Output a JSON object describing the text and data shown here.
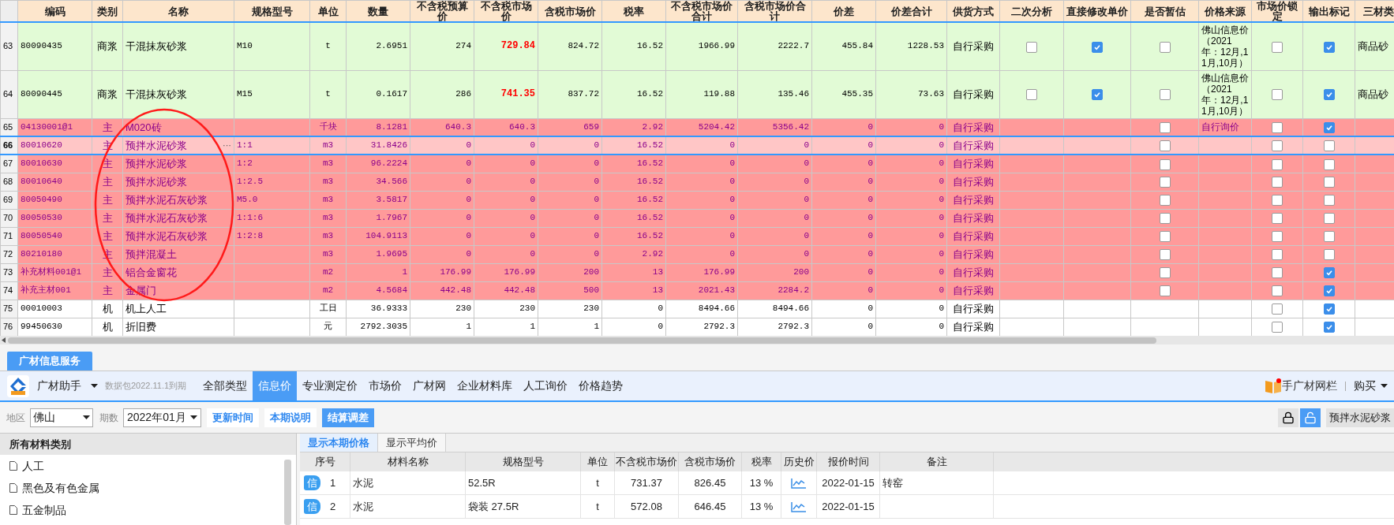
{
  "material_table": {
    "columns": [
      "编码",
      "类别",
      "名称",
      "规格型号",
      "单位",
      "数量",
      "不含税预算价",
      "不含税市场价",
      "含税市场价",
      "税率",
      "不含税市场价合计",
      "含税市场价合计",
      "价差",
      "价差合计",
      "供货方式",
      "二次分析",
      "直接修改单价",
      "是否暂估",
      "价格来源",
      "市场价锁定",
      "输出标记",
      "三材类"
    ],
    "rows": [
      {
        "no": "63",
        "kind": "priced",
        "selected": false,
        "market_highlight": true,
        "cells": [
          "80090435",
          "商浆",
          "干混抹灰砂浆",
          "M10",
          "t",
          "2.6951",
          "274",
          "729.84",
          "824.72",
          "16.52",
          "1966.99",
          "2222.7",
          "455.84",
          "1228.53",
          "自行采购"
        ],
        "secondary": false,
        "direct_edit": true,
        "provisional": false,
        "price_source": "佛山信息价（2021年：12月,11月,10月）",
        "locked": false,
        "output": true,
        "three_materials": "商品砂"
      },
      {
        "no": "64",
        "kind": "priced",
        "selected": false,
        "market_highlight": true,
        "cells": [
          "80090445",
          "商浆",
          "干混抹灰砂浆",
          "M15",
          "t",
          "0.1617",
          "286",
          "741.35",
          "837.72",
          "16.52",
          "119.88",
          "135.46",
          "455.35",
          "73.63",
          "自行采购"
        ],
        "secondary": false,
        "direct_edit": true,
        "provisional": false,
        "price_source": "佛山信息价（2021年：12月,11月,10月）",
        "locked": false,
        "output": true,
        "three_materials": "商品砂"
      },
      {
        "no": "65",
        "kind": "main",
        "selected": false,
        "market_highlight": false,
        "cells": [
          "04130001@1",
          "主",
          "M020砖",
          "",
          "千块",
          "8.1281",
          "640.3",
          "640.3",
          "659",
          "2.92",
          "5204.42",
          "5356.42",
          "0",
          "0",
          "自行采购"
        ],
        "provisional": false,
        "price_source": "自行询价",
        "locked": false,
        "output": true
      },
      {
        "no": "66",
        "kind": "main",
        "selected": true,
        "market_highlight": false,
        "picker": "···",
        "cells": [
          "80010620",
          "主",
          "预拌水泥砂浆",
          "1:1",
          "m3",
          "31.8426",
          "0",
          "0",
          "0",
          "16.52",
          "0",
          "0",
          "0",
          "0",
          "自行采购"
        ],
        "provisional": false,
        "locked": false,
        "output": false
      },
      {
        "no": "67",
        "kind": "main",
        "selected": false,
        "market_highlight": false,
        "cells": [
          "80010630",
          "主",
          "预拌水泥砂浆",
          "1:2",
          "m3",
          "96.2224",
          "0",
          "0",
          "0",
          "16.52",
          "0",
          "0",
          "0",
          "0",
          "自行采购"
        ],
        "provisional": false,
        "locked": false,
        "output": false
      },
      {
        "no": "68",
        "kind": "main",
        "selected": false,
        "market_highlight": false,
        "cells": [
          "80010640",
          "主",
          "预拌水泥砂浆",
          "1:2.5",
          "m3",
          "34.566",
          "0",
          "0",
          "0",
          "16.52",
          "0",
          "0",
          "0",
          "0",
          "自行采购"
        ],
        "provisional": false,
        "locked": false,
        "output": false
      },
      {
        "no": "69",
        "kind": "main",
        "selected": false,
        "market_highlight": false,
        "cells": [
          "80050490",
          "主",
          "预拌水泥石灰砂浆",
          "M5.0",
          "m3",
          "3.5817",
          "0",
          "0",
          "0",
          "16.52",
          "0",
          "0",
          "0",
          "0",
          "自行采购"
        ],
        "provisional": false,
        "locked": false,
        "output": false
      },
      {
        "no": "70",
        "kind": "main",
        "selected": false,
        "market_highlight": false,
        "cells": [
          "80050530",
          "主",
          "预拌水泥石灰砂浆",
          "1:1:6",
          "m3",
          "1.7967",
          "0",
          "0",
          "0",
          "16.52",
          "0",
          "0",
          "0",
          "0",
          "自行采购"
        ],
        "provisional": false,
        "locked": false,
        "output": false
      },
      {
        "no": "71",
        "kind": "main",
        "selected": false,
        "market_highlight": false,
        "cells": [
          "80050540",
          "主",
          "预拌水泥石灰砂浆",
          "1:2:8",
          "m3",
          "104.9113",
          "0",
          "0",
          "0",
          "16.52",
          "0",
          "0",
          "0",
          "0",
          "自行采购"
        ],
        "provisional": false,
        "locked": false,
        "output": false
      },
      {
        "no": "72",
        "kind": "main",
        "selected": false,
        "market_highlight": false,
        "cells": [
          "80210180",
          "主",
          "预拌混凝土",
          "",
          "m3",
          "1.9695",
          "0",
          "0",
          "0",
          "2.92",
          "0",
          "0",
          "0",
          "0",
          "自行采购"
        ],
        "provisional": false,
        "locked": false,
        "output": false
      },
      {
        "no": "73",
        "kind": "main",
        "selected": false,
        "market_highlight": false,
        "cells": [
          "补充材料001@1",
          "主",
          "铝合金窗花",
          "",
          "m2",
          "1",
          "176.99",
          "176.99",
          "200",
          "13",
          "176.99",
          "200",
          "0",
          "0",
          "自行采购"
        ],
        "provisional": false,
        "locked": false,
        "output": true
      },
      {
        "no": "74",
        "kind": "main",
        "selected": false,
        "market_highlight": false,
        "cells": [
          "补充主材001",
          "主",
          "金属门",
          "",
          "m2",
          "4.5684",
          "442.48",
          "442.48",
          "500",
          "13",
          "2021.43",
          "2284.2",
          "0",
          "0",
          "自行采购"
        ],
        "provisional": false,
        "locked": false,
        "output": true
      },
      {
        "no": "75",
        "kind": "machine",
        "selected": false,
        "market_highlight": false,
        "cells": [
          "00010003",
          "机",
          "机上人工",
          "",
          "工日",
          "36.9333",
          "230",
          "230",
          "230",
          "0",
          "8494.66",
          "8494.66",
          "0",
          "0",
          "自行采购"
        ],
        "locked": false,
        "output": true
      },
      {
        "no": "76",
        "kind": "machine",
        "selected": false,
        "market_highlight": false,
        "cells": [
          "99450630",
          "机",
          "折旧费",
          "",
          "元",
          "2792.3035",
          "1",
          "1",
          "1",
          "0",
          "2792.3",
          "2792.3",
          "0",
          "0",
          "自行采购"
        ],
        "locked": false,
        "output": true
      }
    ]
  },
  "service_tab": {
    "label": "广材信息服务"
  },
  "toolbar": {
    "app_name": "广材助手",
    "package_note": "数据包2022.11.1到期",
    "nav": [
      {
        "label": "全部类型",
        "selected": false
      },
      {
        "label": "信息价",
        "selected": true
      },
      {
        "label": "专业测定价",
        "selected": false
      },
      {
        "label": "市场价",
        "selected": false
      },
      {
        "label": "广材网",
        "selected": false
      },
      {
        "label": "企业材料库",
        "selected": false
      },
      {
        "label": "人工询价",
        "selected": false
      },
      {
        "label": "价格趋势",
        "selected": false
      }
    ],
    "link": "手广材网栏",
    "buy": "购买"
  },
  "filters": {
    "region_label": "地区",
    "region": "佛山",
    "period_label": "期数",
    "period": "2022年01月",
    "buttons": [
      {
        "label": "更新时间",
        "primary": false
      },
      {
        "label": "本期说明",
        "primary": false
      },
      {
        "label": "结算调差",
        "primary": true
      }
    ],
    "lock_modes": [
      {
        "kind": "lock",
        "selected": false
      },
      {
        "kind": "unlock",
        "selected": true
      }
    ],
    "search_tag": "预拌水泥砂浆"
  },
  "categories": {
    "title": "所有材料类别",
    "items": [
      "人工",
      "黑色及有色金属",
      "五金制品"
    ]
  },
  "price_panel": {
    "tabs": [
      {
        "label": "显示本期价格",
        "selected": true
      },
      {
        "label": "显示平均价",
        "selected": false
      }
    ],
    "columns": [
      "序号",
      "材料名称",
      "规格型号",
      "单位",
      "不含税市场价",
      "含税市场价",
      "税率",
      "历史价",
      "报价时间",
      "备注"
    ],
    "rows": [
      {
        "badge": "信",
        "no": "1",
        "name": "水泥",
        "spec": "52.5R",
        "unit": "t",
        "price_ex": "731.37",
        "price_in": "826.45",
        "rate": "13 %",
        "time": "2022-01-15",
        "note": "转窑"
      },
      {
        "badge": "信",
        "no": "2",
        "name": "水泥",
        "spec": "袋装 27.5R",
        "unit": "t",
        "price_ex": "572.08",
        "price_in": "646.45",
        "rate": "13 %",
        "time": "2022-01-15"
      }
    ]
  }
}
